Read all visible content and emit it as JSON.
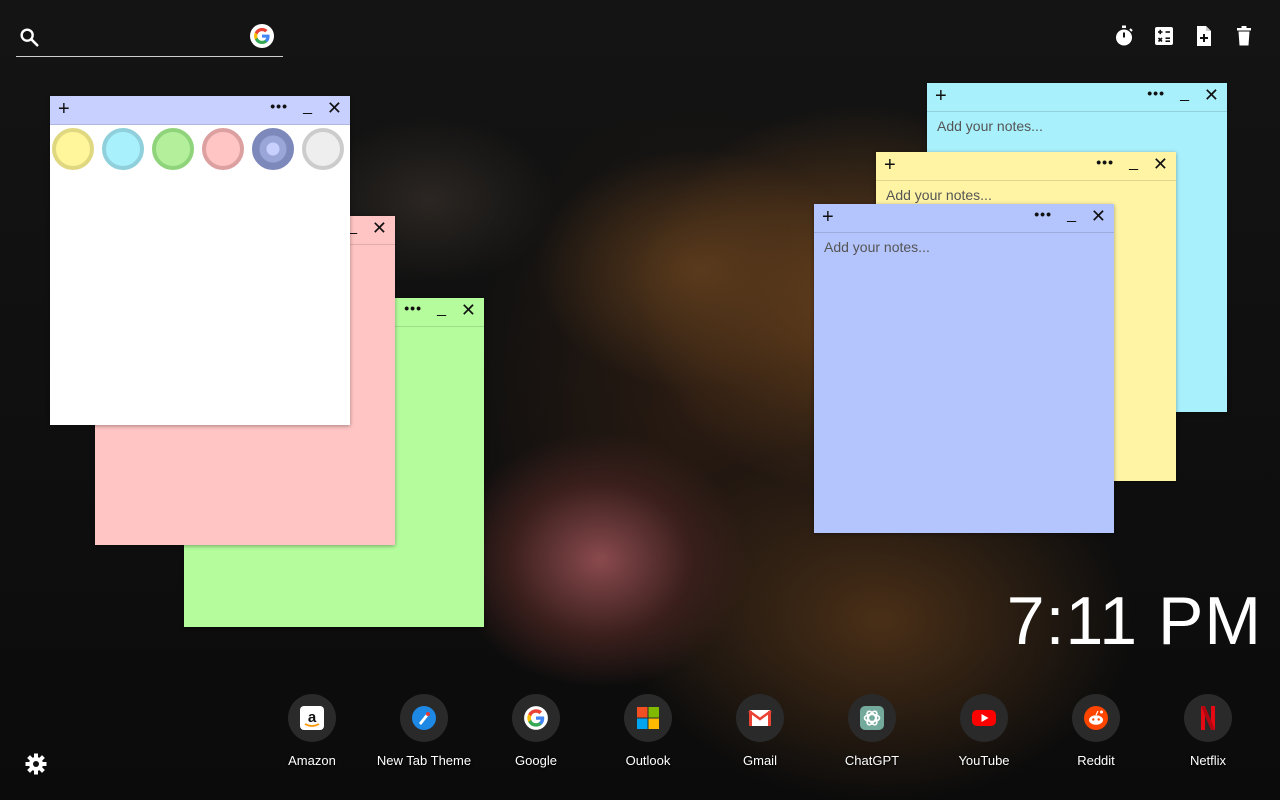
{
  "search": {
    "placeholder": "",
    "icon": "search-icon",
    "engine_icon": "google-g-icon"
  },
  "toolbar": {
    "items": [
      {
        "name": "timer",
        "icon": "timer-icon"
      },
      {
        "name": "calculator",
        "icon": "calculator-icon"
      },
      {
        "name": "new-note",
        "icon": "add-note-icon"
      },
      {
        "name": "delete",
        "icon": "trash-icon"
      }
    ]
  },
  "notes": {
    "placeholder": "Add your notes...",
    "plus": "+",
    "dots": "•••",
    "min": "_",
    "close": "✕",
    "colors": {
      "white": "#ffffff",
      "pink": "#ffc4c4",
      "green": "#b4fc9c",
      "cyan": "#a8f0fc",
      "yellow": "#fff4a4",
      "blue": "#b4c4fc",
      "bar_white": "#c8d0ff"
    },
    "swatches": [
      {
        "name": "yellow",
        "fill": "#fff59a",
        "ring": "#e0d880"
      },
      {
        "name": "cyan",
        "fill": "#a8f0fc",
        "ring": "#8fd0dc"
      },
      {
        "name": "green",
        "fill": "#b4f09c",
        "ring": "#8fd47a"
      },
      {
        "name": "pink",
        "fill": "#ffc4c4",
        "ring": "#dca0a0"
      },
      {
        "name": "blue",
        "fill": "#9aa6d8",
        "ring": "#7d88bb",
        "selected": true
      },
      {
        "name": "white",
        "fill": "#eeeeee",
        "ring": "#cccccc"
      }
    ]
  },
  "clock": {
    "time": "7:11 PM"
  },
  "shortcuts": [
    {
      "label": "Amazon",
      "icon": "amazon-icon"
    },
    {
      "label": "New Tab Theme",
      "icon": "new-tab-theme-icon"
    },
    {
      "label": "Google",
      "icon": "google-icon"
    },
    {
      "label": "Outlook",
      "icon": "outlook-icon"
    },
    {
      "label": "Gmail",
      "icon": "gmail-icon"
    },
    {
      "label": "ChatGPT",
      "icon": "chatgpt-icon"
    },
    {
      "label": "YouTube",
      "icon": "youtube-icon"
    },
    {
      "label": "Reddit",
      "icon": "reddit-icon"
    },
    {
      "label": "Netflix",
      "icon": "netflix-icon"
    }
  ],
  "settings": {
    "icon": "gear-icon"
  }
}
